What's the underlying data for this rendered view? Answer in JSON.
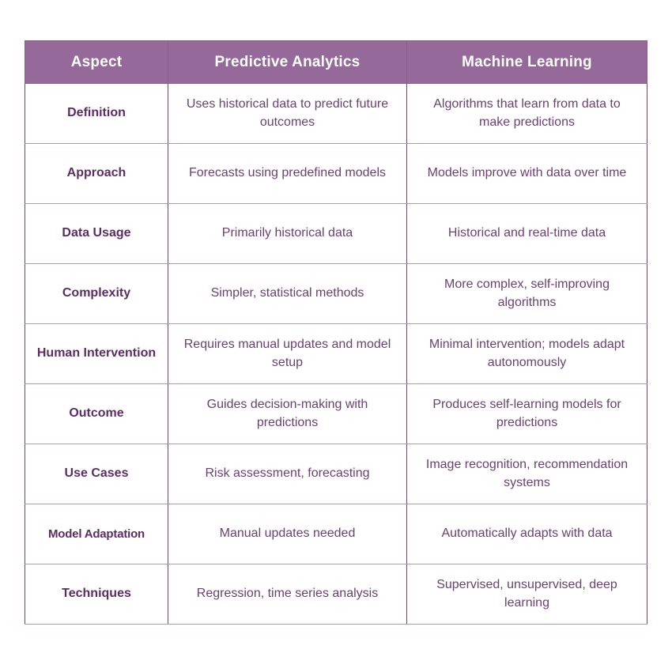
{
  "table": {
    "columns": [
      "Aspect",
      "Predictive Analytics",
      "Machine Learning"
    ],
    "rows": [
      {
        "aspect": "Definition",
        "predictive_analytics": "Uses historical data to predict future outcomes",
        "machine_learning": "Algorithms that learn from data to make predictions"
      },
      {
        "aspect": "Approach",
        "predictive_analytics": "Forecasts using predefined models",
        "machine_learning": "Models improve with data over time"
      },
      {
        "aspect": "Data Usage",
        "predictive_analytics": "Primarily historical data",
        "machine_learning": "Historical and real-time data"
      },
      {
        "aspect": "Complexity",
        "predictive_analytics": "Simpler, statistical methods",
        "machine_learning": "More complex, self-improving algorithms"
      },
      {
        "aspect": "Human Intervention",
        "predictive_analytics": "Requires manual updates and model setup",
        "machine_learning": "Minimal intervention; models adapt autonomously"
      },
      {
        "aspect": "Outcome",
        "predictive_analytics": "Guides decision-making with predictions",
        "machine_learning": "Produces self-learning models for predictions"
      },
      {
        "aspect": "Use Cases",
        "predictive_analytics": "Risk assessment, forecasting",
        "machine_learning": "Image recognition, recommendation systems"
      },
      {
        "aspect": "Model Adaptation",
        "predictive_analytics": "Manual updates needed",
        "machine_learning": "Automatically adapts with data"
      },
      {
        "aspect": "Techniques",
        "predictive_analytics": "Regression, time series analysis",
        "machine_learning": "Supervised, unsupervised, deep learning"
      }
    ]
  },
  "colors": {
    "header_background": "#96699b",
    "header_text": "#ffffff",
    "aspect_text": "#5c2d63",
    "body_text": "#6b3f72",
    "border_strong": "#6f4577",
    "border_light": "#b295b7",
    "page_background": "#ffffff"
  }
}
